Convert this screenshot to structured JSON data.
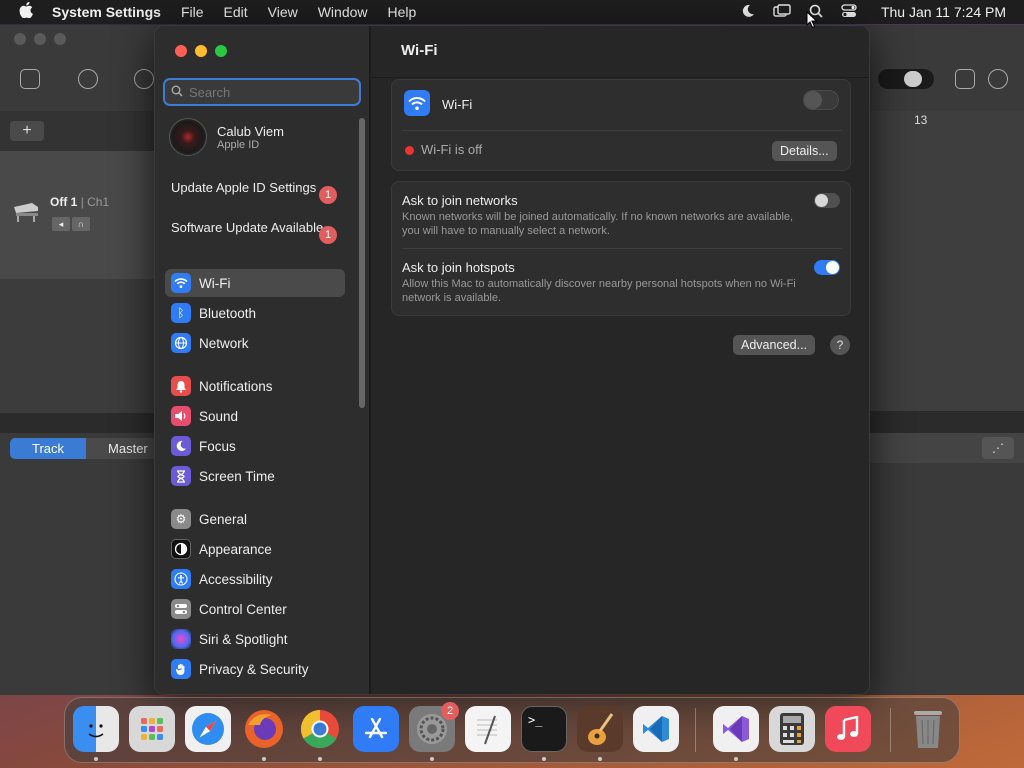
{
  "menubar": {
    "app": "System Settings",
    "menus": [
      "File",
      "Edit",
      "View",
      "Window",
      "Help"
    ],
    "clock": "Thu Jan 11  7:24 PM"
  },
  "garageband": {
    "track_name": "Off 1",
    "track_sub": "| Ch1",
    "tab_track": "Track",
    "tab_master": "Master",
    "ruler_number": "13"
  },
  "sidebar": {
    "search_placeholder": "Search",
    "profile": {
      "name": "Calub Viem",
      "sub": "Apple ID"
    },
    "notices": [
      {
        "label": "Update Apple ID Settings",
        "badge": "1"
      },
      {
        "label": "Software Update Available",
        "badge": "1"
      }
    ],
    "items": [
      {
        "label": "Wi-Fi",
        "icon": "wifi-icon",
        "color": "#2f7cf6"
      },
      {
        "label": "Bluetooth",
        "icon": "bluetooth-icon",
        "color": "#2f7cf6"
      },
      {
        "label": "Network",
        "icon": "globe-icon",
        "color": "#2f7cf6"
      },
      {
        "label": "Notifications",
        "icon": "bell-icon",
        "color": "#e84d4d"
      },
      {
        "label": "Sound",
        "icon": "speaker-icon",
        "color": "#e84d6d"
      },
      {
        "label": "Focus",
        "icon": "moon-icon",
        "color": "#6b5bd6"
      },
      {
        "label": "Screen Time",
        "icon": "hourglass-icon",
        "color": "#6b5bd6"
      },
      {
        "label": "General",
        "icon": "gear-icon",
        "color": "#8a8a8a"
      },
      {
        "label": "Appearance",
        "icon": "appearance-icon",
        "color": "#111111"
      },
      {
        "label": "Accessibility",
        "icon": "accessibility-icon",
        "color": "#2f7cf6"
      },
      {
        "label": "Control Center",
        "icon": "control-center-icon",
        "color": "#8a8a8a"
      },
      {
        "label": "Siri & Spotlight",
        "icon": "siri-icon",
        "color": "#b044c8"
      },
      {
        "label": "Privacy & Security",
        "icon": "hand-icon",
        "color": "#2f7cf6"
      }
    ]
  },
  "content": {
    "title": "Wi-Fi",
    "wifi_label": "Wi-Fi",
    "wifi_status": "Wi-Fi is off",
    "details_button": "Details...",
    "ask_networks": {
      "label": "Ask to join networks",
      "desc": "Known networks will be joined automatically. If no known networks are available, you will have to manually select a network."
    },
    "ask_hotspots": {
      "label": "Ask to join hotspots",
      "desc": "Allow this Mac to automatically discover nearby personal hotspots when no Wi-Fi network is available."
    },
    "advanced_button": "Advanced...",
    "help_button": "?"
  },
  "dock": {
    "apps": [
      {
        "name": "finder",
        "color": "#3a8ef0"
      },
      {
        "name": "launchpad",
        "color": "#d0d0d0"
      },
      {
        "name": "safari",
        "color": "#2f8cf0"
      },
      {
        "name": "firefox",
        "color": "#e8622a"
      },
      {
        "name": "chrome",
        "color": "#f0f0f0"
      },
      {
        "name": "app-store",
        "color": "#2f7cf6"
      },
      {
        "name": "system-settings",
        "color": "#7a7a7a",
        "badge": "2"
      },
      {
        "name": "textedit",
        "color": "#f4f4f4"
      },
      {
        "name": "terminal",
        "color": "#1a1a1a"
      },
      {
        "name": "garageband",
        "color": "#6a3a1a"
      },
      {
        "name": "vscode",
        "color": "#f0f0f0"
      },
      {
        "name": "visual-studio",
        "color": "#f0f0f0"
      },
      {
        "name": "calculator",
        "color": "#d8d8d8"
      },
      {
        "name": "music",
        "color": "#f04a5a"
      },
      {
        "name": "trash",
        "color": "#8a8a8a"
      }
    ]
  }
}
